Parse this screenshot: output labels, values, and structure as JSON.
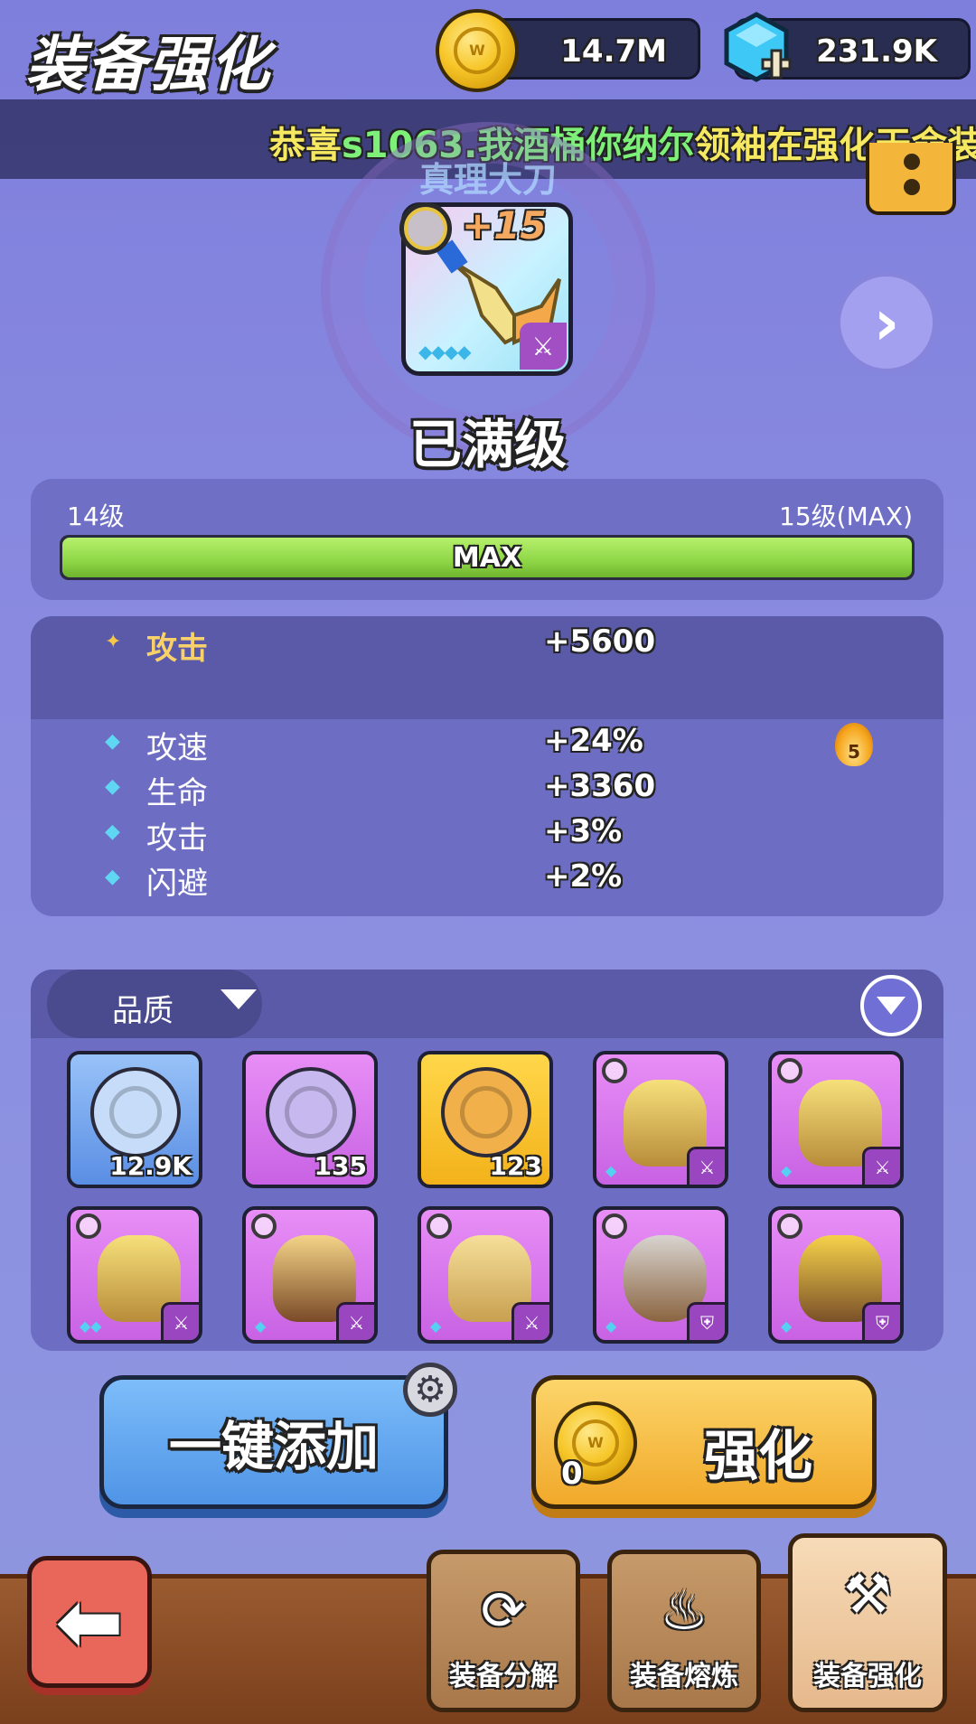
{
  "header": {
    "title": "装备强化",
    "coins": "14.7M",
    "gems": "231.9K"
  },
  "ticker": {
    "prefix": "恭喜",
    "player": "s1063.我酒桶你纳尔",
    "suffix": "领袖在强化天命装备"
  },
  "item": {
    "name": "真理大刀",
    "level_badge": "+15",
    "status": "已满级",
    "gem_count": 4,
    "class_icon": "sword-icon"
  },
  "level": {
    "current": "14级",
    "next": "15级(MAX)",
    "bar_text": "MAX",
    "progress": 1.0
  },
  "stats": {
    "main": {
      "label": "攻击",
      "value": "+5600"
    },
    "sub": [
      {
        "label": "攻速",
        "value": "+24%"
      },
      {
        "label": "生命",
        "value": "+3360"
      },
      {
        "label": "攻击",
        "value": "+3%"
      },
      {
        "label": "闪避",
        "value": "+2%"
      }
    ],
    "flame_level": "5"
  },
  "inventory": {
    "sort_label": "品质",
    "slots": [
      {
        "kind": "token",
        "color": "blue",
        "count": "12.9K"
      },
      {
        "kind": "token",
        "color": "purple",
        "count": "135"
      },
      {
        "kind": "token",
        "color": "gold",
        "count": "123"
      },
      {
        "kind": "helmet",
        "color": "purple",
        "gems": 1,
        "class": "sword-icon"
      },
      {
        "kind": "helmet",
        "color": "purple",
        "gems": 1,
        "class": "sword-icon"
      },
      {
        "kind": "helmet",
        "color": "purple",
        "gems": 2,
        "class": "sword-icon"
      },
      {
        "kind": "armor",
        "color": "purple",
        "gems": 1,
        "class": "sword-icon"
      },
      {
        "kind": "boots",
        "color": "purple",
        "gems": 1,
        "class": "sword-icon"
      },
      {
        "kind": "mask",
        "color": "purple",
        "gems": 1,
        "class": "shield-icon"
      },
      {
        "kind": "hood",
        "color": "purple",
        "gems": 1,
        "class": "shield-icon"
      }
    ]
  },
  "buttons": {
    "auto_add": "一键添加",
    "enhance": "强化",
    "cost": "0"
  },
  "tabs": [
    {
      "label": "装备分解",
      "icon": "recycle-icon"
    },
    {
      "label": "装备熔炼",
      "icon": "furnace-icon"
    },
    {
      "label": "装备强化",
      "icon": "anvil-icon"
    }
  ],
  "colors": {
    "accent_gold": "#f3b21a",
    "purple_rarity": "#c862e4",
    "progress_green": "#8ed646"
  }
}
